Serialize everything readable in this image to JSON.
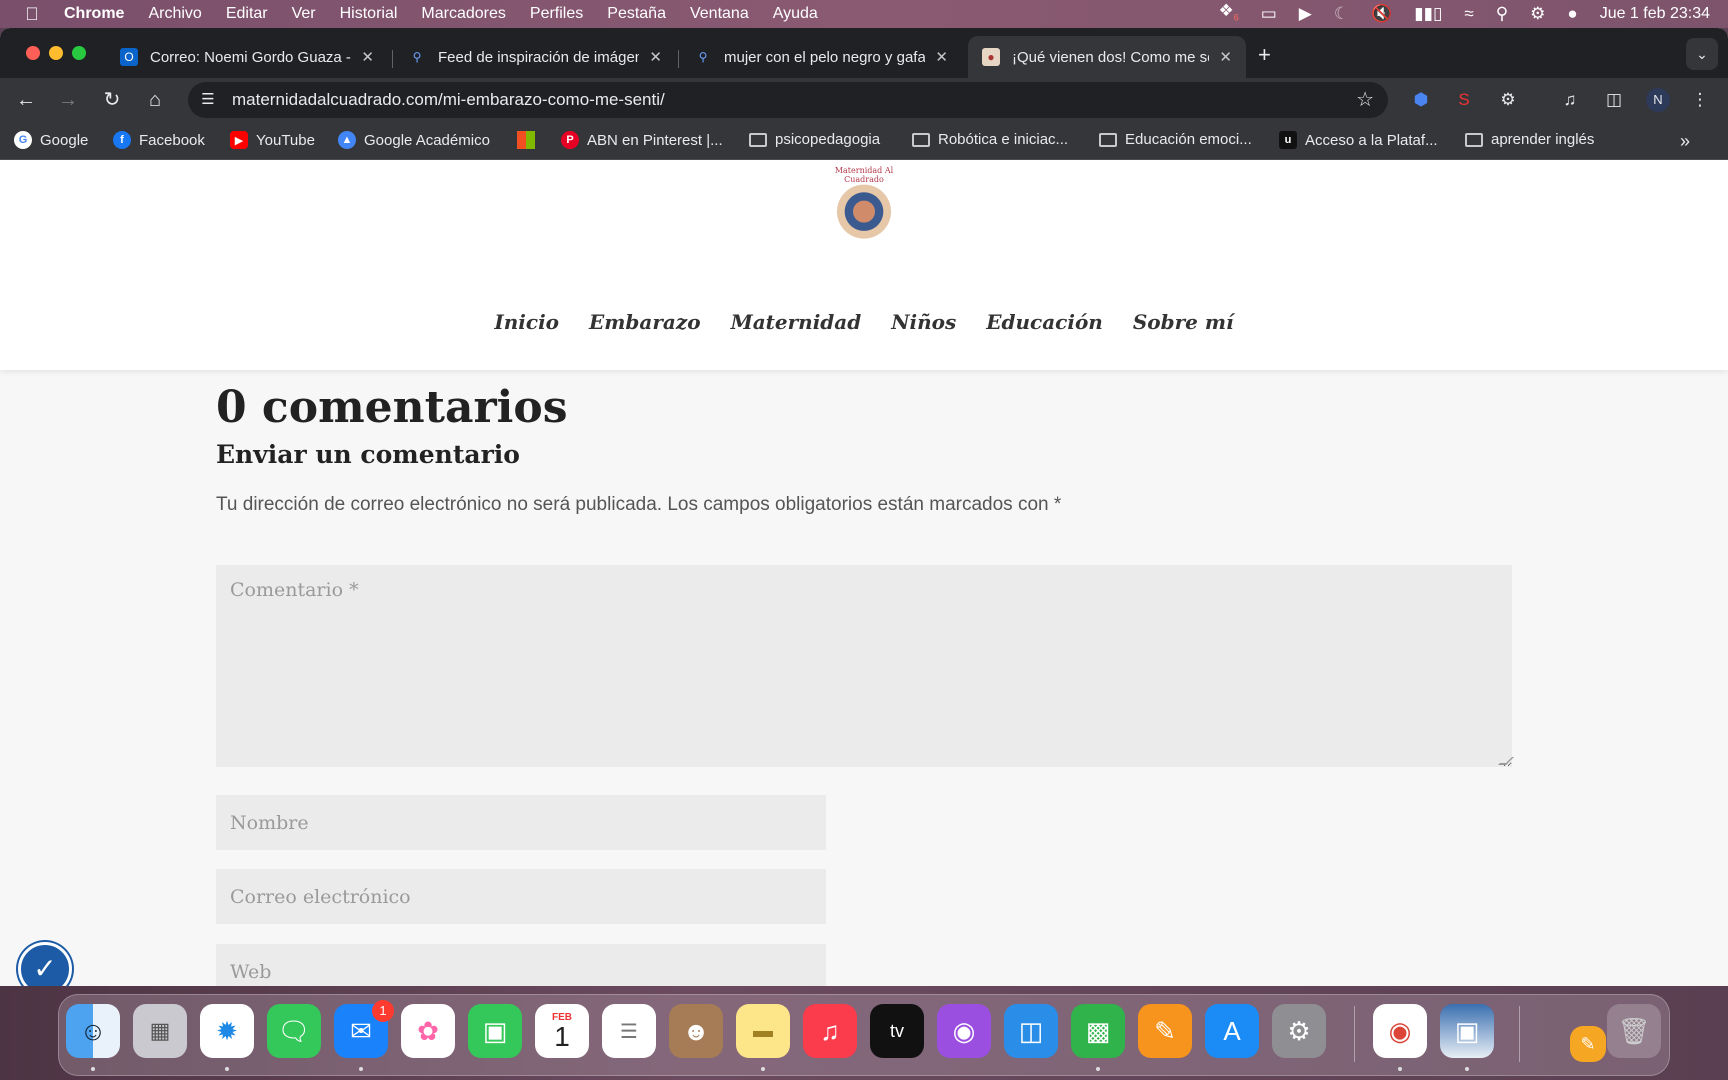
{
  "menubar": {
    "apple": "",
    "items": [
      "Chrome",
      "Archivo",
      "Editar",
      "Ver",
      "Historial",
      "Marcadores",
      "Perfiles",
      "Pestaña",
      "Ventana",
      "Ayuda"
    ],
    "clock": "Jue 1 feb 23:34",
    "dropbox_badge": "6"
  },
  "tabs": [
    {
      "title": "Correo: Noemi Gordo Guaza -",
      "favicon": "outlook-icon"
    },
    {
      "title": "Feed de inspiración de imágenes",
      "favicon": "search-icon"
    },
    {
      "title": "mujer con el pelo negro y gafas",
      "favicon": "search-icon"
    },
    {
      "title": "¡Qué vienen dos! Como me sentí",
      "favicon": "site-icon",
      "active": true
    }
  ],
  "toolbar": {
    "url": "maternidadalcuadrado.com/mi-embarazo-como-me-senti/",
    "profile_initial": "N"
  },
  "bookmarks": [
    {
      "label": "Google",
      "type": "site"
    },
    {
      "label": "Facebook",
      "type": "site"
    },
    {
      "label": "YouTube",
      "type": "site"
    },
    {
      "label": "Google Académico",
      "type": "site"
    },
    {
      "label": "",
      "type": "microsoft"
    },
    {
      "label": "ABN en Pinterest |...",
      "type": "site"
    },
    {
      "label": "psicopedagogia",
      "type": "folder"
    },
    {
      "label": "Robótica e iniciac...",
      "type": "folder"
    },
    {
      "label": "Educación emoci...",
      "type": "folder"
    },
    {
      "label": "Acceso a la Plataf...",
      "type": "site"
    },
    {
      "label": "aprender inglés",
      "type": "folder"
    }
  ],
  "site": {
    "logo_text": "Maternidad Al Cuadrado",
    "nav": [
      "Inicio",
      "Embarazo",
      "Maternidad",
      "Niños",
      "Educación",
      "Sobre mí"
    ]
  },
  "comments": {
    "count_title": "0 comentarios",
    "reply_title": "Enviar un comentario",
    "notes": "Tu dirección de correo electrónico no será publicada. Los campos obligatorios están marcados con *",
    "comment_placeholder": "Comentario *",
    "name_placeholder": "Nombre",
    "email_placeholder": "Correo electrónico",
    "web_placeholder": "Web"
  },
  "dock": {
    "mail_badge": "1",
    "calendar_month": "FEB",
    "calendar_day": "1",
    "tv_label": "tv"
  }
}
